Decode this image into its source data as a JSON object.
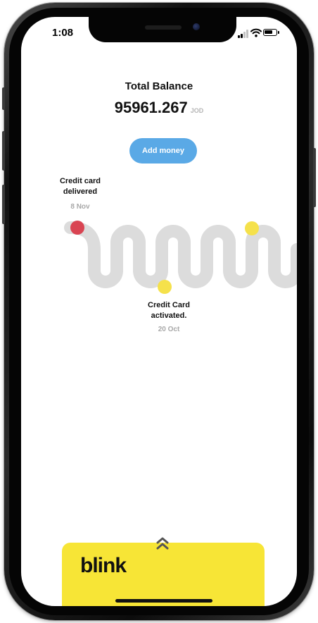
{
  "status_bar": {
    "time": "1:08"
  },
  "balance": {
    "title": "Total Balance",
    "amount": "95961.267",
    "currency": "JOD"
  },
  "actions": {
    "add_money_label": "Add money"
  },
  "timeline": {
    "events": [
      {
        "title_line1": "Credit card",
        "title_line2": "delivered",
        "date": "8 Nov",
        "dot_color": "#d94452"
      },
      {
        "title_line1": "Credit Card",
        "title_line2": "activated.",
        "date": "20 Oct",
        "dot_color": "#f5e14b"
      },
      {
        "dot_color": "#f5e14b"
      }
    ],
    "path_color": "#dcdcdc"
  },
  "card": {
    "brand_text": "blink",
    "color": "#f7e536"
  }
}
